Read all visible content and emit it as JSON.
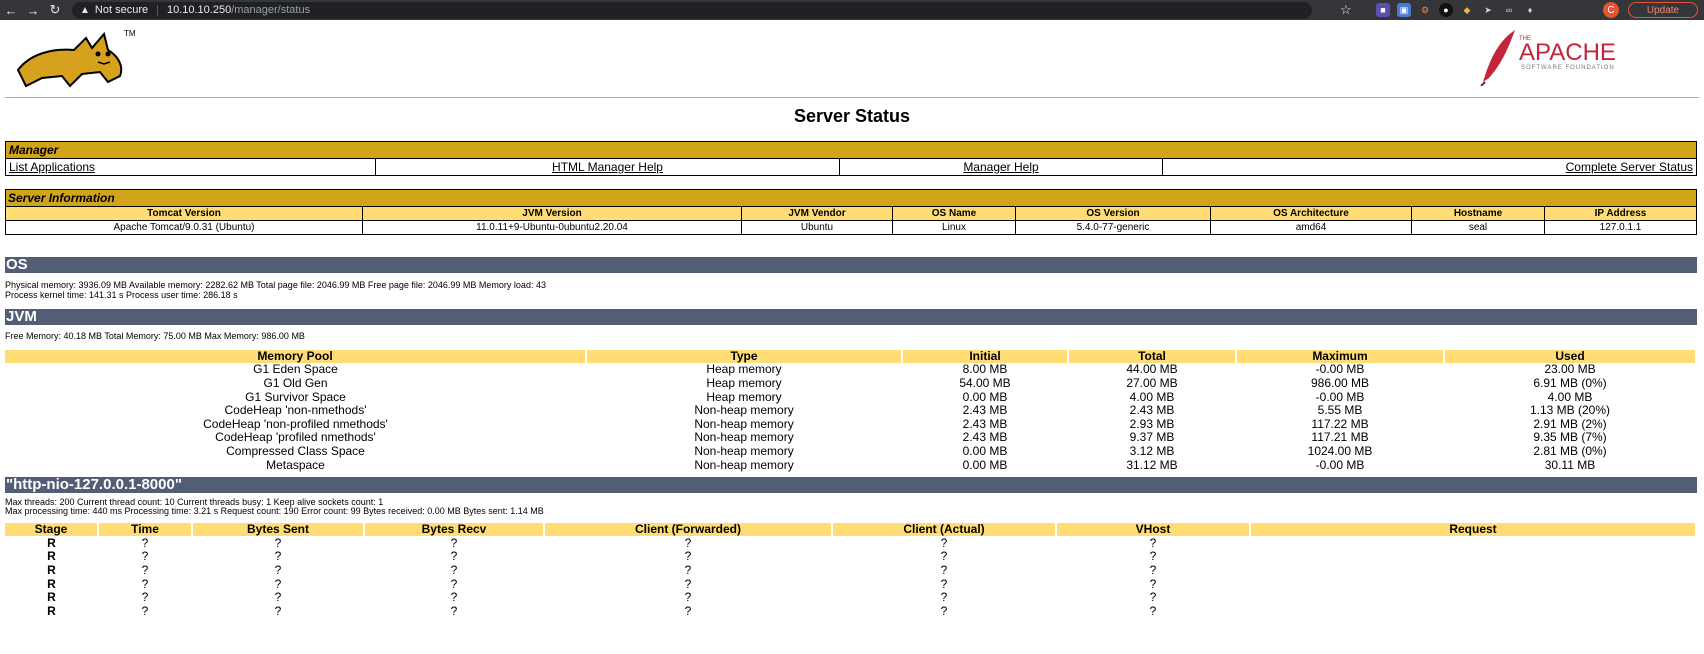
{
  "browser": {
    "insecure_label": "Not secure",
    "url_host": "10.10.10.250",
    "url_path": "/manager/status",
    "avatar_letter": "C",
    "update_label": "Update"
  },
  "logos": {
    "tomcat_tm": "TM",
    "apache_the": "THE",
    "apache_name": "APACHE",
    "apache_sub": "SOFTWARE FOUNDATION"
  },
  "title": "Server Status",
  "manager": {
    "heading": "Manager",
    "links": [
      "List Applications",
      "HTML Manager Help",
      "Manager Help",
      "Complete Server Status"
    ]
  },
  "server_info": {
    "heading": "Server Information",
    "columns": [
      "Tomcat Version",
      "JVM Version",
      "JVM Vendor",
      "OS Name",
      "OS Version",
      "OS Architecture",
      "Hostname",
      "IP Address"
    ],
    "values": [
      "Apache Tomcat/9.0.31 (Ubuntu)",
      "11.0.11+9-Ubuntu-0ubuntu2.20.04",
      "Ubuntu",
      "Linux",
      "5.4.0-77-generic",
      "amd64",
      "seal",
      "127.0.1.1"
    ]
  },
  "os": {
    "heading": "OS",
    "line1": "Physical memory: 3936.09 MB Available memory: 2282.62 MB Total page file: 2046.99 MB Free page file: 2046.99 MB Memory load: 43",
    "line2": "Process kernel time: 141.31 s Process user time: 286.18 s"
  },
  "jvm": {
    "heading": "JVM",
    "line": "Free Memory: 40.18 MB Total Memory: 75.00 MB Max Memory: 986.00 MB",
    "columns": [
      "Memory Pool",
      "Type",
      "Initial",
      "Total",
      "Maximum",
      "Used"
    ],
    "rows": [
      [
        "G1 Eden Space",
        "Heap memory",
        "8.00 MB",
        "44.00 MB",
        "-0.00 MB",
        "23.00 MB"
      ],
      [
        "G1 Old Gen",
        "Heap memory",
        "54.00 MB",
        "27.00 MB",
        "986.00 MB",
        "6.91 MB (0%)"
      ],
      [
        "G1 Survivor Space",
        "Heap memory",
        "0.00 MB",
        "4.00 MB",
        "-0.00 MB",
        "4.00 MB"
      ],
      [
        "CodeHeap 'non-nmethods'",
        "Non-heap memory",
        "2.43 MB",
        "2.43 MB",
        "5.55 MB",
        "1.13 MB (20%)"
      ],
      [
        "CodeHeap 'non-profiled nmethods'",
        "Non-heap memory",
        "2.43 MB",
        "2.93 MB",
        "117.22 MB",
        "2.91 MB (2%)"
      ],
      [
        "CodeHeap 'profiled nmethods'",
        "Non-heap memory",
        "2.43 MB",
        "9.37 MB",
        "117.21 MB",
        "9.35 MB (7%)"
      ],
      [
        "Compressed Class Space",
        "Non-heap memory",
        "0.00 MB",
        "3.12 MB",
        "1024.00 MB",
        "2.81 MB (0%)"
      ],
      [
        "Metaspace",
        "Non-heap memory",
        "0.00 MB",
        "31.12 MB",
        "-0.00 MB",
        "30.11 MB"
      ]
    ]
  },
  "connector": {
    "heading": "\"http-nio-127.0.0.1-8000\"",
    "line1": "Max threads: 200 Current thread count: 10 Current threads busy: 1 Keep alive sockets count: 1",
    "line2": "Max processing time: 440 ms Processing time: 3.21 s Request count: 190 Error count: 99 Bytes received: 0.00 MB Bytes sent: 1.14 MB",
    "columns": [
      "Stage",
      "Time",
      "Bytes Sent",
      "Bytes Recv",
      "Client (Forwarded)",
      "Client (Actual)",
      "VHost",
      "Request"
    ],
    "rows": [
      [
        "R",
        "?",
        "?",
        "?",
        "?",
        "?",
        "?",
        ""
      ],
      [
        "R",
        "?",
        "?",
        "?",
        "?",
        "?",
        "?",
        ""
      ],
      [
        "R",
        "?",
        "?",
        "?",
        "?",
        "?",
        "?",
        ""
      ],
      [
        "R",
        "?",
        "?",
        "?",
        "?",
        "?",
        "?",
        ""
      ],
      [
        "R",
        "?",
        "?",
        "?",
        "?",
        "?",
        "?",
        ""
      ],
      [
        "R",
        "?",
        "?",
        "?",
        "?",
        "?",
        "?",
        ""
      ]
    ]
  }
}
